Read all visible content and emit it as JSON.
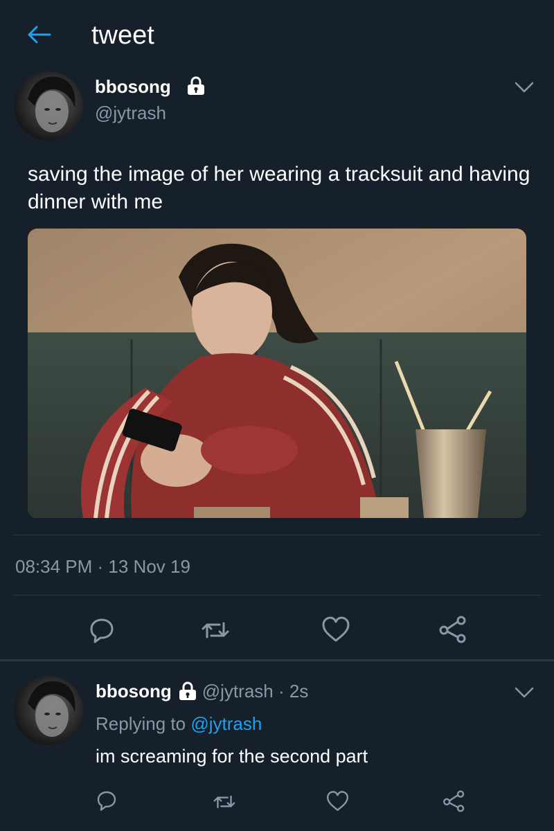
{
  "header": {
    "title": "tweet",
    "back_icon": "arrow-left-icon"
  },
  "colors": {
    "background": "#15202b",
    "accent": "#1da1f2",
    "secondary_text": "#8899a6",
    "divider": "#2c3a47"
  },
  "tweet": {
    "author_name": "bbosong",
    "author_handle": "@jytrash",
    "protected_icon": "lock-icon",
    "menu_icon": "chevron-down-icon",
    "text": "saving the image of her wearing a tracksuit and having dinner with me",
    "timestamp": "08:34 PM · 13 Nov 19",
    "actions": [
      "comment-icon",
      "retweet-icon",
      "heart-icon",
      "share-icon"
    ]
  },
  "reply": {
    "author_name": "bbosong",
    "author_handle": "@jytrash",
    "separator": " · ",
    "age": "2s",
    "replying_prefix": "Replying to ",
    "replying_to": "@jytrash",
    "text": "im screaming for the second part",
    "actions": [
      "comment-icon",
      "retweet-icon",
      "heart-icon",
      "share-icon"
    ]
  }
}
